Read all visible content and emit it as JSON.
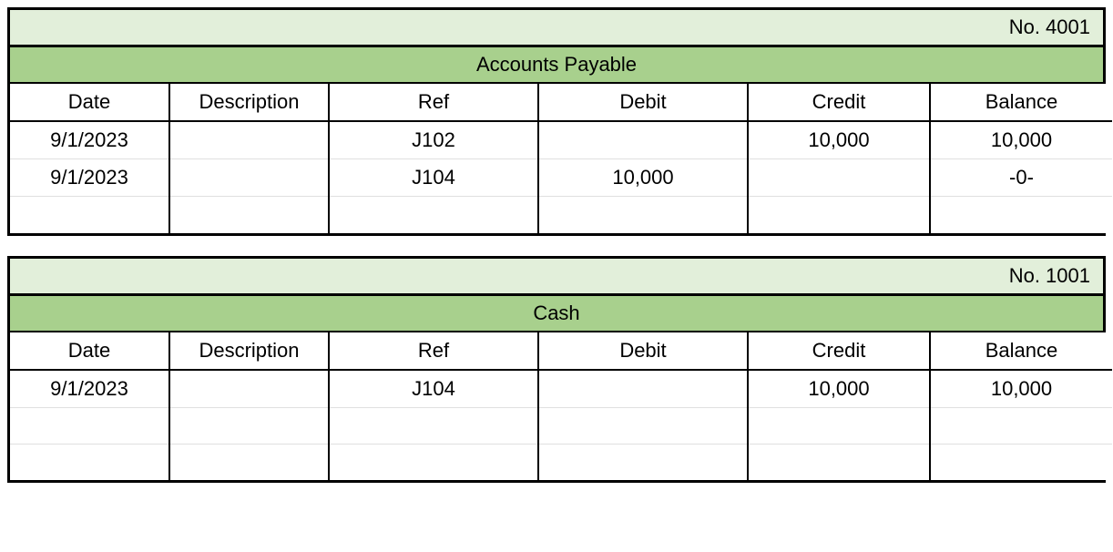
{
  "ledgers": [
    {
      "account_no": "No. 4001",
      "account_name": "Accounts Payable",
      "columns": [
        "Date",
        "Description",
        "Ref",
        "Debit",
        "Credit",
        "Balance"
      ],
      "rows": [
        {
          "date": "9/1/2023",
          "description": "",
          "ref": "J102",
          "debit": "",
          "credit": "10,000",
          "balance": "10,000"
        },
        {
          "date": "9/1/2023",
          "description": "",
          "ref": "J104",
          "debit": "10,000",
          "credit": "",
          "balance": "-0-"
        },
        {
          "date": "",
          "description": "",
          "ref": "",
          "debit": "",
          "credit": "",
          "balance": ""
        }
      ]
    },
    {
      "account_no": "No. 1001",
      "account_name": "Cash",
      "columns": [
        "Date",
        "Description",
        "Ref",
        "Debit",
        "Credit",
        "Balance"
      ],
      "rows": [
        {
          "date": "9/1/2023",
          "description": "",
          "ref": "J104",
          "debit": "",
          "credit": "10,000",
          "balance": "10,000"
        },
        {
          "date": "",
          "description": "",
          "ref": "",
          "debit": "",
          "credit": "",
          "balance": ""
        },
        {
          "date": "",
          "description": "",
          "ref": "",
          "debit": "",
          "credit": "",
          "balance": ""
        }
      ]
    }
  ]
}
